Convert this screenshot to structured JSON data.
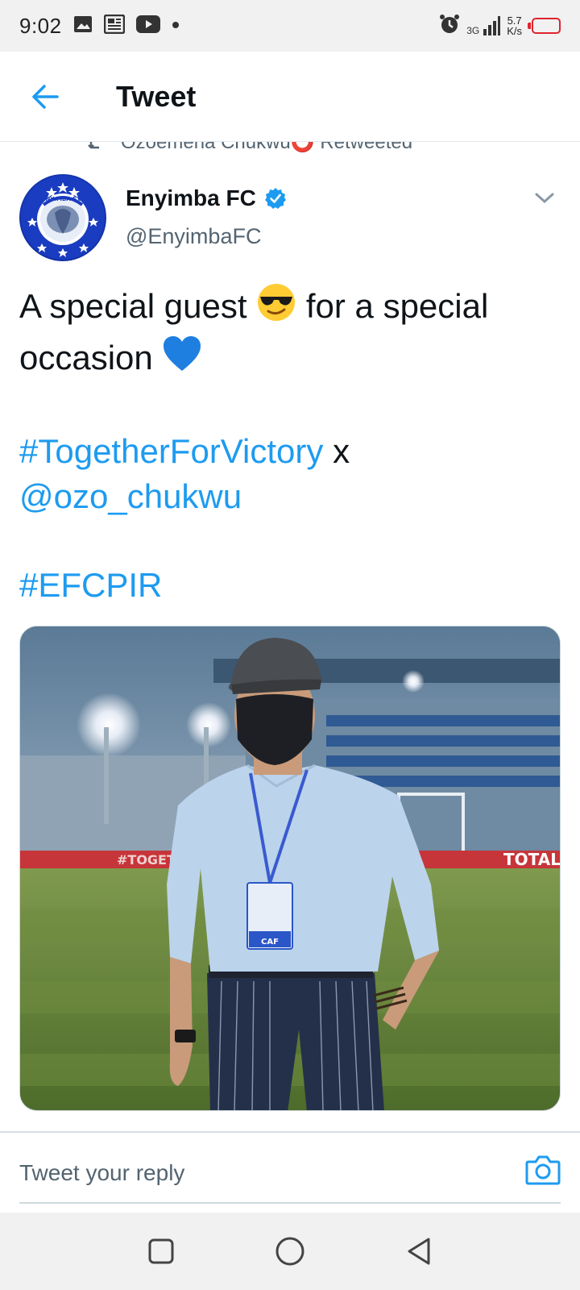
{
  "status_bar": {
    "time": "9:02",
    "network_label": "3G",
    "net_speed_value": "5.7",
    "net_speed_unit": "K/s",
    "icons": [
      "image-icon",
      "news-icon",
      "youtube-icon",
      "dot-icon",
      "alarm-icon",
      "signal-icon",
      "battery-icon"
    ],
    "battery_color": "#e0242e"
  },
  "header": {
    "title": "Tweet",
    "back_icon": "arrow-left-icon",
    "accent": "#1d9bf0"
  },
  "retweet": {
    "text": "Ozoemena Chukwu⭕ Retweeted",
    "icon": "retweet-icon"
  },
  "tweet": {
    "author_name": "Enyimba FC",
    "author_handle": "@EnyimbaFC",
    "verified": true,
    "avatar_text": "ENYIMBA FOOTBALL CLUB",
    "text_line1": "A special guest",
    "emoji1": "😎",
    "text_line1b": "for a special",
    "text_line2": "occasion",
    "emoji2": "💙",
    "hashtag1": "#TogetherForVictory",
    "connector": "x",
    "mention": "@ozo_chukwu",
    "hashtag2": "#EFCPIR",
    "media": {
      "stadium_banner_left": "#TOGETHER",
      "stadium_banner_right": "TOTAL",
      "badge_text": "CAF"
    }
  },
  "reply": {
    "placeholder": "Tweet your reply",
    "camera_icon": "camera-icon"
  },
  "nav": {
    "icons": [
      "recents-square-icon",
      "home-circle-icon",
      "back-triangle-icon"
    ]
  }
}
